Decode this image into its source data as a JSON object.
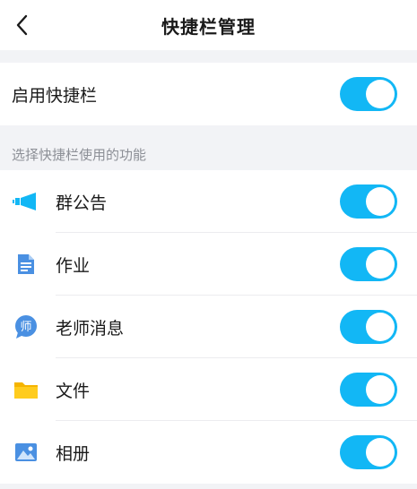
{
  "header": {
    "title": "快捷栏管理"
  },
  "enable": {
    "label": "启用快捷栏",
    "on": true
  },
  "section_heading": "选择快捷栏使用的功能",
  "features": [
    {
      "label": "群公告",
      "icon": "megaphone-icon",
      "on": true
    },
    {
      "label": "作业",
      "icon": "document-icon",
      "on": true
    },
    {
      "label": "老师消息",
      "icon": "teacher-message-icon",
      "on": true
    },
    {
      "label": "文件",
      "icon": "folder-icon",
      "on": true
    },
    {
      "label": "相册",
      "icon": "photo-album-icon",
      "on": true
    }
  ],
  "colors": {
    "toggle_on": "#12b7f5",
    "background": "#f2f3f6"
  }
}
